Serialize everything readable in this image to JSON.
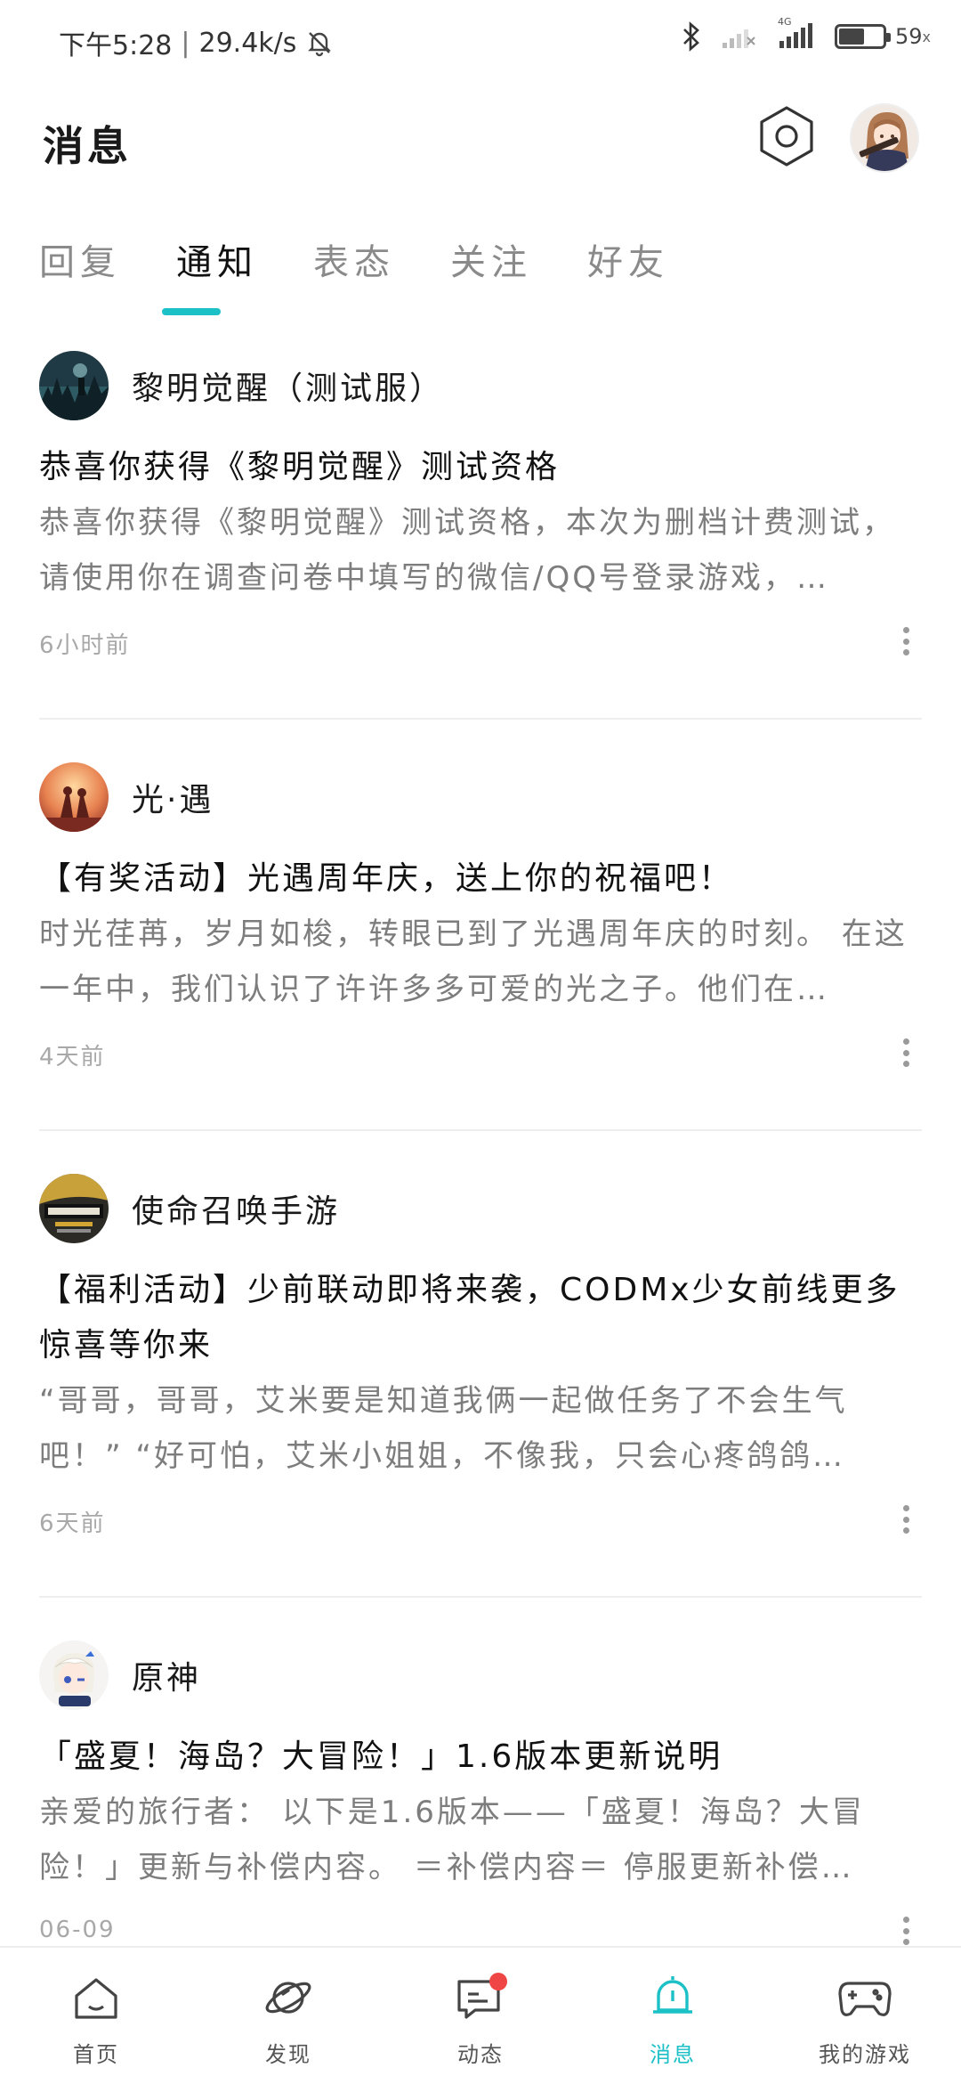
{
  "status_bar": {
    "time": "下午5:28",
    "net_speed": "29.4k/s",
    "network_label": "4G",
    "battery": "59",
    "battery_level": 0.59
  },
  "header": {
    "title": "消息"
  },
  "tabs": [
    {
      "label": "回复",
      "active": false
    },
    {
      "label": "通知",
      "active": true
    },
    {
      "label": "表态",
      "active": false
    },
    {
      "label": "关注",
      "active": false
    },
    {
      "label": "好友",
      "active": false
    }
  ],
  "notifications": [
    {
      "game": "黎明觉醒（测试服）",
      "title": "恭喜你获得《黎明觉醒》测试资格",
      "body": "恭喜你获得《黎明觉醒》测试资格，本次为删档计费测试，请使用你在调查问卷中填写的微信/QQ号登录游戏，…",
      "time": "6小时前"
    },
    {
      "game": "光·遇",
      "title": "【有奖活动】光遇周年庆，送上你的祝福吧！",
      "body": "时光荏苒，岁月如梭，转眼已到了光遇周年庆的时刻。 在这一年中，我们认识了许许多多可爱的光之子。他们在…",
      "time": "4天前"
    },
    {
      "game": "使命召唤手游",
      "title": "【福利活动】少前联动即将来袭，CODMx少女前线更多惊喜等你来",
      "body": "“哥哥，哥哥，艾米要是知道我俩一起做任务了不会生气吧！” “好可怕，艾米小姐姐，不像我，只会心疼鸽鸽…",
      "time": "6天前"
    },
    {
      "game": "原神",
      "title": "「盛夏！海岛？大冒险！」1.6版本更新说明",
      "body": "亲爱的旅行者： 以下是1.6版本——「盛夏！海岛？大冒险！」更新与补偿内容。 ＝补偿内容＝ 停服更新补偿…",
      "time": "06-09"
    }
  ],
  "bottom_nav": [
    {
      "label": "首页",
      "icon": "home-icon",
      "active": false
    },
    {
      "label": "发现",
      "icon": "planet-icon",
      "active": false
    },
    {
      "label": "动态",
      "icon": "chat-icon",
      "active": false,
      "badge": true
    },
    {
      "label": "消息",
      "icon": "bell-icon",
      "active": true
    },
    {
      "label": "我的游戏",
      "icon": "gamepad-icon",
      "active": false
    }
  ],
  "colors": {
    "accent": "#1cc0c7",
    "badge": "#f04545",
    "muted_text": "#7d7d7d",
    "time_text": "#a8a8a8"
  }
}
